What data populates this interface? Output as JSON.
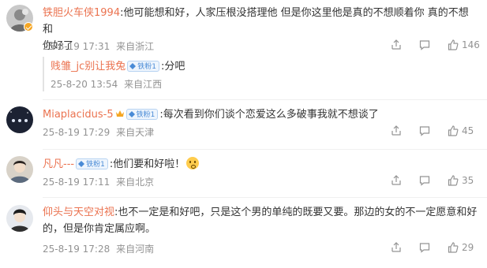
{
  "icons": {
    "share": "share-icon",
    "comment": "comment-icon",
    "like": "like-icon",
    "fan_badge": "fan-level-icon",
    "verified": "verified-badge-icon",
    "crown": "crown-icon"
  },
  "colors": {
    "username": "#eb7350",
    "meta": "#939393",
    "badge_border": "#b7d3f2",
    "badge_text": "#4a8bd6"
  },
  "comments": [
    {
      "username": "铁胆火车侠1994",
      "text": ":他可能想和好，人家压根没搭理他 但是你这里他是真的不想顺着你 真的不想和",
      "text2": "你好了",
      "time": "25-8-19 17:31",
      "location": "来自浙江",
      "likes": "146",
      "reply": {
        "username": "贱雏_jc别让我兔",
        "badge": "铁粉1",
        "text": ":分吧",
        "time": "25-8-20 13:54",
        "location": "来自江西"
      }
    },
    {
      "username": "Miaplacidus-5",
      "badge": "铁粉1",
      "text": ":每次看到你们谈个恋爱这么多破事我就不想谈了",
      "time": "25-8-19 17:29",
      "location": "来自天津",
      "likes": "45"
    },
    {
      "username": "凡凡---",
      "badge": "铁粉1",
      "text": ":他们要和好啦！",
      "time": "25-8-19 17:11",
      "location": "来自北京",
      "likes": "35"
    },
    {
      "username": "仰头与天空对视",
      "text": ":也不一定是和好吧，只是这个男的单纯的既要又要。那边的女的不一定愿意和好",
      "text2": "的，但是你肯定属应啊。",
      "time": "25-8-19 17:28",
      "location": "来自河南",
      "likes": "29"
    }
  ]
}
